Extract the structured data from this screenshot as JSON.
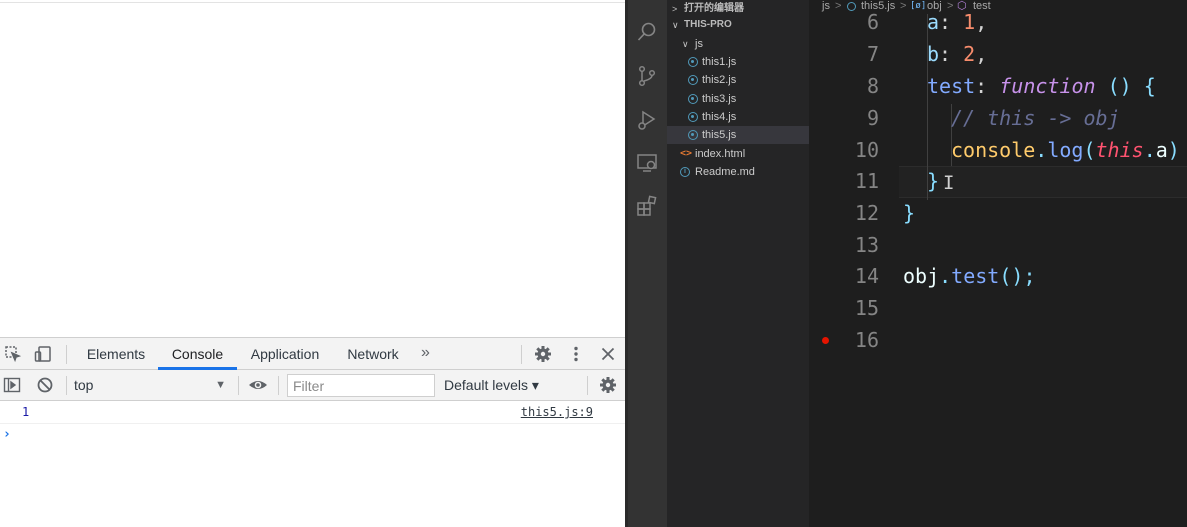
{
  "devtools": {
    "tabs": [
      "Elements",
      "Console",
      "Application",
      "Network"
    ],
    "active_tab": "Console",
    "more_tabs_glyph": "»",
    "context": "top",
    "filter_placeholder": "Filter",
    "levels": "Default levels ▾",
    "icons": [
      "inspect-element-icon",
      "device-toolbar-icon",
      "settings-icon",
      "kebab-menu-icon",
      "close-icon",
      "sidebar-toggle-icon",
      "clear-console-icon",
      "eye-icon",
      "console-settings-icon"
    ]
  },
  "console": {
    "messages": [
      {
        "value": "1",
        "source": "this5.js:9"
      }
    ],
    "prompt": "›"
  },
  "vscode": {
    "activity_icons": [
      "explorer-search-icon",
      "source-control-icon",
      "run-debug-icon",
      "remote-explorer-icon",
      "extensions-icon"
    ],
    "sidebar": {
      "open_editors": "打开的编辑器",
      "project": "THIS-PRO",
      "folder": "js",
      "files": [
        "this1.js",
        "this2.js",
        "this3.js",
        "this4.js",
        "this5.js"
      ],
      "selected_file": "this5.js",
      "root_files": [
        "index.html",
        "Readme.md"
      ]
    },
    "breadcrumb": {
      "folder": "js",
      "file": "this5.js",
      "obj_glyph": "[ø]",
      "obj": "obj",
      "method": "test"
    },
    "editor": {
      "line_numbers": [
        "6",
        "7",
        "8",
        "9",
        "10",
        "11",
        "12",
        "13",
        "14",
        "15",
        "16"
      ],
      "breakpoint_line": "16",
      "code": {
        "l6_key": "a",
        "l6_colon": ": ",
        "l6_val": "1",
        "l6_comma": ",",
        "l7_key": "b",
        "l7_colon": ": ",
        "l7_val": "2",
        "l7_comma": ",",
        "l8_key": "test",
        "l8_colon": ": ",
        "l8_kw": "function",
        "l8_sp": " ",
        "l8_parens": "()",
        "l8_brace": " {",
        "l9_comment": "// this -> obj",
        "l10_obj": "console",
        "l10_dot": ".",
        "l10_fn": "log",
        "l10_open": "(",
        "l10_this": "this",
        "l10_dot2": ".",
        "l10_prop": "a",
        "l10_close": ")",
        "l11_brace": "}",
        "l12_brace": "}",
        "l14_obj": "obj",
        "l14_dot": ".",
        "l14_fn": "test",
        "l14_parens": "()",
        "l14_semi": ";"
      },
      "cursor_glyph": "I"
    }
  }
}
